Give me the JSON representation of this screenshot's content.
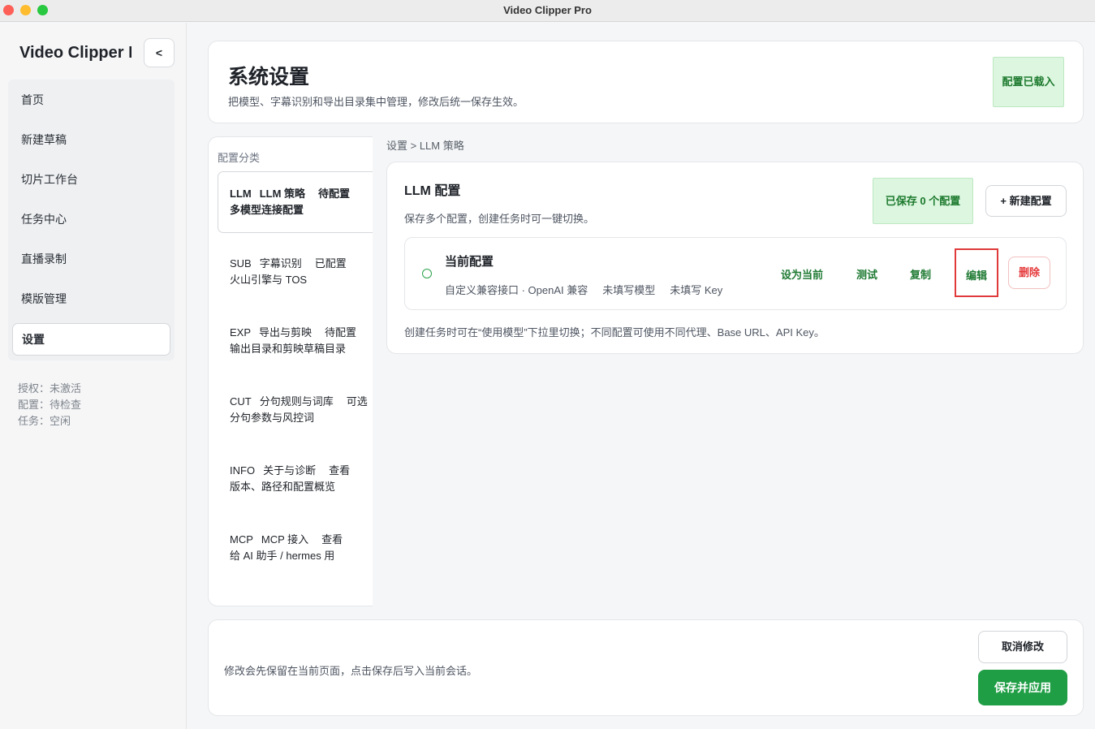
{
  "window": {
    "title": "Video Clipper Pro"
  },
  "sidebar": {
    "app_name": "Video Clipper Pro",
    "collapse_label": "<",
    "items": [
      {
        "label": "首页"
      },
      {
        "label": "新建草稿"
      },
      {
        "label": "切片工作台"
      },
      {
        "label": "任务中心"
      },
      {
        "label": "直播录制"
      },
      {
        "label": "模版管理"
      },
      {
        "label": "设置",
        "active": true
      }
    ],
    "status": [
      "授权：未激活",
      "配置：待检查",
      "任务：空闲"
    ]
  },
  "header": {
    "title": "系统设置",
    "subtitle": "把模型、字幕识别和导出目录集中管理，修改后统一保存生效。",
    "badge": "配置已载入"
  },
  "categories": {
    "title": "配置分类",
    "items": [
      {
        "code": "LLM",
        "name": "LLM 策略",
        "status": "待配置",
        "desc": "多模型连接配置",
        "active": true
      },
      {
        "code": "SUB",
        "name": "字幕识别",
        "status": "已配置",
        "desc": "火山引擎与 TOS"
      },
      {
        "code": "EXP",
        "name": "导出与剪映",
        "status": "待配置",
        "desc": "输出目录和剪映草稿目录"
      },
      {
        "code": "CUT",
        "name": "分句规则与词库",
        "status": "可选",
        "desc": "分句参数与风控词"
      },
      {
        "code": "INFO",
        "name": "关于与诊断",
        "status": "查看",
        "desc": "版本、路径和配置概览"
      },
      {
        "code": "MCP",
        "name": "MCP 接入",
        "status": "查看",
        "desc": "给 AI 助手 / hermes 用"
      }
    ]
  },
  "breadcrumb": "设置 > LLM 策略",
  "llm": {
    "title": "LLM 配置",
    "desc": "保存多个配置，创建任务时可一键切换。",
    "saved_badge": "已保存 0 个配置",
    "new_button": "+ 新建配置",
    "config": {
      "name": "当前配置",
      "meta": [
        "自定义兼容接口 · OpenAI 兼容",
        "未填写模型",
        "未填写 Key"
      ],
      "actions": {
        "set_current": "设为当前",
        "test": "测试",
        "copy": "复制",
        "edit": "编辑",
        "delete": "删除"
      }
    },
    "note": "创建任务时可在“使用模型”下拉里切换；不同配置可使用不同代理、Base URL、API Key。"
  },
  "footer": {
    "note": "修改会先保留在当前页面，点击保存后写入当前会话。",
    "cancel": "取消修改",
    "save": "保存并应用"
  },
  "colors": {
    "accent_green": "#1f9e45",
    "badge_green_bg": "#dcf6df",
    "danger_red": "#e5393b",
    "highlight_red": "#e03a3a"
  }
}
